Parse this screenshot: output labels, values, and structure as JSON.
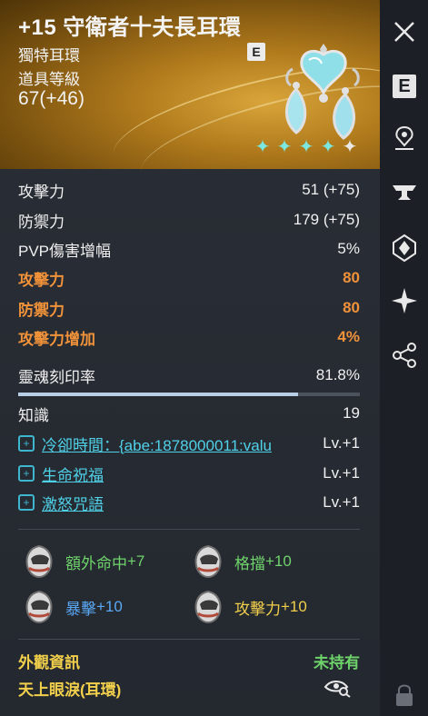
{
  "item": {
    "title": "+15 守衛者十夫長耳環",
    "type": "獨特耳環",
    "level_label": "道具等級",
    "level": "67(+46)",
    "badge": "E",
    "gems_filled": 5,
    "gems_total": 5
  },
  "stats": [
    {
      "label": "攻擊力",
      "value": "51 (+75)",
      "color": "white"
    },
    {
      "label": "防禦力",
      "value": "179 (+75)",
      "color": "white"
    },
    {
      "label": "PVP傷害增幅",
      "value": "5%",
      "color": "white"
    },
    {
      "label": "攻擊力",
      "value": "80",
      "color": "orange"
    },
    {
      "label": "防禦力",
      "value": "80",
      "color": "orange"
    },
    {
      "label": "攻擊力增加",
      "value": "4%",
      "color": "orange"
    }
  ],
  "soul": {
    "label": "靈魂刻印率",
    "value": "81.8%",
    "fill_fraction": 0.818
  },
  "knowledge": {
    "label": "知識",
    "value": "19"
  },
  "skills": [
    {
      "name": "冷卻時間：{abe:1878000011:valu",
      "level": "Lv.+1"
    },
    {
      "name": "生命祝福",
      "level": "Lv.+1"
    },
    {
      "name": "激怒咒語",
      "level": "Lv.+1"
    }
  ],
  "bonuses": [
    {
      "label": "額外命中",
      "value": "+7",
      "color": "green"
    },
    {
      "label": "格擋",
      "value": "+10",
      "color": "green"
    },
    {
      "label": "暴擊",
      "value": "+10",
      "color": "blue"
    },
    {
      "label": "攻擊力",
      "value": "+10",
      "color": "yellow"
    }
  ],
  "appearance": {
    "label": "外觀資訊",
    "status": "未持有",
    "name": "天上眼淚(耳環)"
  },
  "sidebar": {
    "e_label": "E"
  }
}
